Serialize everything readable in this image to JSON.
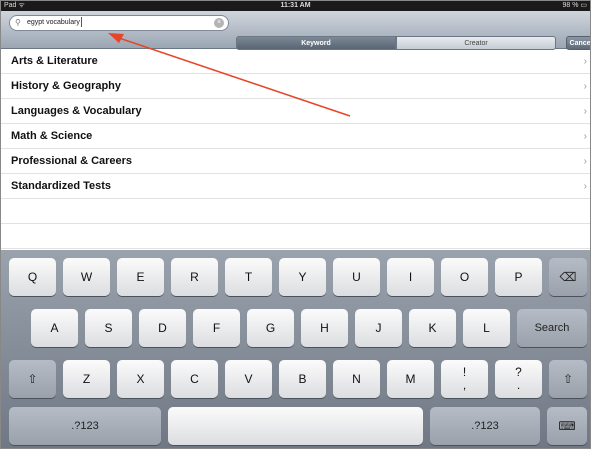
{
  "status_bar": {
    "carrier": "Pad ᯤ",
    "time": "11:31 AM",
    "battery": "98 % ▭"
  },
  "search": {
    "query": "egypt vocabulary",
    "keyword_tab": "Keyword",
    "creator_tab": "Creator",
    "cancel_label": "Cancel"
  },
  "categories": [
    "Arts & Literature",
    "History & Geography",
    "Languages & Vocabulary",
    "Math & Science",
    "Professional & Careers",
    "Standardized Tests"
  ],
  "keyboard": {
    "row1": [
      "Q",
      "W",
      "E",
      "R",
      "T",
      "Y",
      "U",
      "I",
      "O",
      "P"
    ],
    "row2": [
      "A",
      "S",
      "D",
      "F",
      "G",
      "H",
      "J",
      "K",
      "L"
    ],
    "row3": [
      "Z",
      "X",
      "C",
      "V",
      "B",
      "N",
      "M"
    ],
    "search_label": "Search",
    "numbers_label": ".?123",
    "punct1": "!\n,",
    "punct2": "?\n."
  },
  "annotation_color": "#e8442a"
}
